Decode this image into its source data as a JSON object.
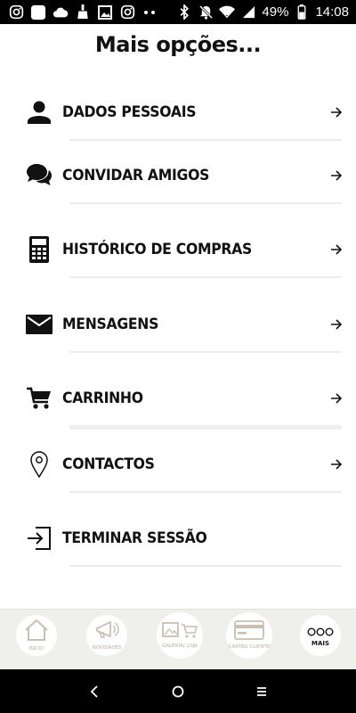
{
  "status_bar": {
    "battery_percent": "49%",
    "time": "14:08",
    "icons": [
      "instagram-icon",
      "app-icon",
      "cloud-icon",
      "cleaner-icon",
      "image-icon",
      "instagram-icon",
      "more-dots-icon",
      "bluetooth-icon",
      "notifications-off-icon",
      "wifi-icon",
      "signal-icon",
      "battery-icon"
    ]
  },
  "page": {
    "title": "Mais opções..."
  },
  "menu": {
    "items": [
      {
        "label": "DADOS PESSOAIS",
        "icon": "person-icon"
      },
      {
        "label": "CONVIDAR AMIGOS",
        "icon": "chat-bubbles-icon"
      },
      {
        "label": "HISTÓRICO DE COMPRAS",
        "icon": "calculator-icon"
      },
      {
        "label": "MENSAGENS",
        "icon": "envelope-icon"
      },
      {
        "label": "CARRINHO",
        "icon": "cart-icon"
      },
      {
        "label": "CONTACTOS",
        "icon": "location-pin-icon"
      },
      {
        "label": "TERMINAR SESSÃO",
        "icon": "logout-icon"
      }
    ]
  },
  "tabs": [
    {
      "label": "INÍCIO",
      "icon": "home-icon"
    },
    {
      "label": "NOVIDADES",
      "icon": "megaphone-icon"
    },
    {
      "label": "GALERIA/ LOJA",
      "icon": "gallery-cart-icon"
    },
    {
      "label": "CARTÃO CLIENTE",
      "icon": "card-icon"
    },
    {
      "label": "MAIS",
      "icon": "more-circles-icon",
      "active": true
    }
  ],
  "colors": {
    "tab_bar_bg": "#efefeb",
    "tab_inactive": "#b9ad9f",
    "text": "#111111"
  }
}
